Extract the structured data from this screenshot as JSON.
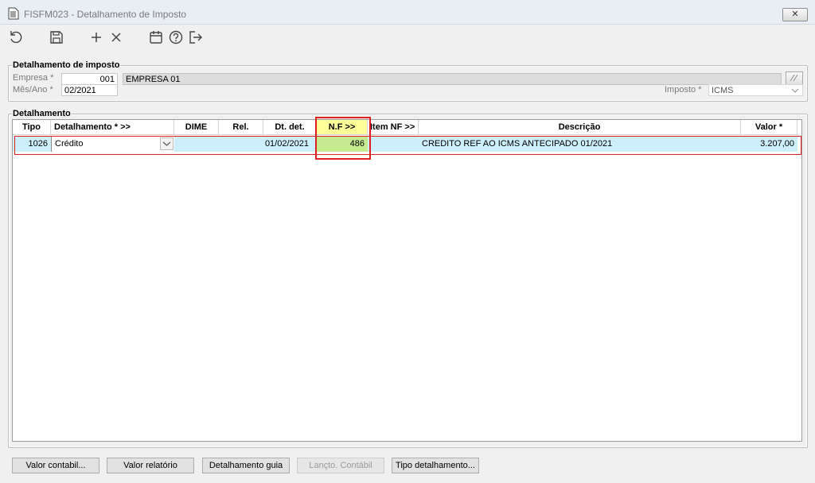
{
  "window": {
    "title": "FISFM023 - Detalhamento de Imposto",
    "close_label": "✕"
  },
  "toolbar": [
    {
      "name": "refresh-icon"
    },
    {
      "name": "save-icon"
    },
    {
      "name": "add-icon"
    },
    {
      "name": "delete-icon"
    },
    {
      "name": "calendar-icon"
    },
    {
      "name": "help-icon"
    },
    {
      "name": "exit-icon"
    }
  ],
  "header": {
    "legend": "Detalhamento de imposto",
    "empresa_label": "Empresa *",
    "empresa_code": "001",
    "empresa_name": "EMPRESA 01",
    "mesano_label": "Mês/Ano *",
    "mesano_value": "02/2021",
    "imposto_label": "Imposto *",
    "imposto_value": "ICMS"
  },
  "detail": {
    "legend": "Detalhamento",
    "columns": [
      "Tipo",
      "Detalhamento *  >>",
      "DIME",
      "Rel.",
      "Dt. det.",
      "N.F  >>",
      "Item NF  >>",
      "Descrição",
      "Valor *"
    ],
    "row": {
      "tipo": "1026",
      "detalhamento": "Crédito",
      "dime": "",
      "rel": "",
      "dt_det": "01/02/2021",
      "nf": "486",
      "item_nf": "",
      "descricao": "CREDITO REF AO ICMS ANTECIPADO 01/2021",
      "valor": "3.207,00"
    }
  },
  "buttons": {
    "valor_contabil": "Valor contabil...",
    "valor_relatorio": "Valor relatório",
    "detalhamento_guia": "Detalhamento guia",
    "lancto_contabil": "Lançto. Contábil",
    "tipo_detalhamento": "Tipo detalhamento..."
  },
  "colors": {
    "selected_row": "#cdeefb",
    "nf_header": "#ffff99",
    "nf_cell": "#c6ea8f",
    "highlight": "#e02020"
  }
}
